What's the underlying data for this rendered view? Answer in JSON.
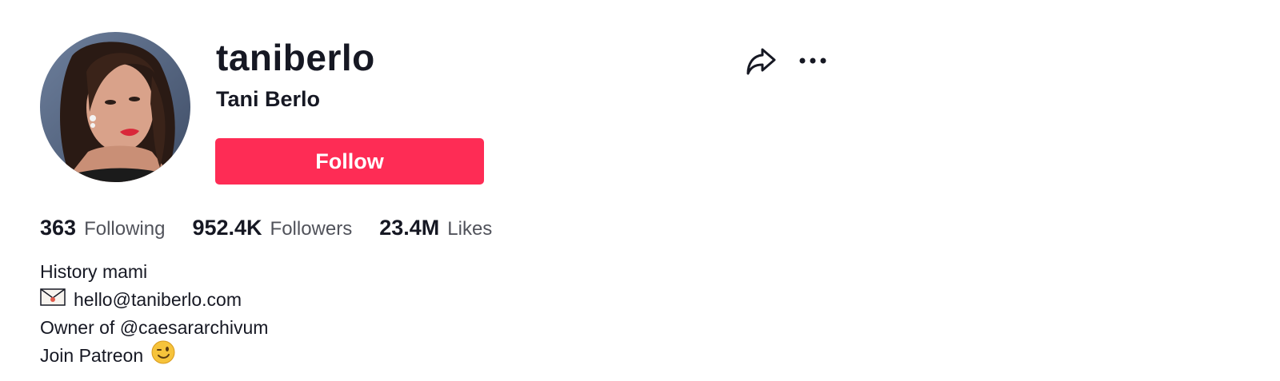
{
  "profile": {
    "username": "taniberlo",
    "nickname": "Tani Berlo",
    "avatar_icon": "profile-photo",
    "follow_label": "Follow",
    "accent_color": "#fe2c55"
  },
  "actions": {
    "share_icon": "share-arrow-icon",
    "more_icon": "more-dots-icon"
  },
  "stats": [
    {
      "value": "363",
      "label": "Following"
    },
    {
      "value": "952.4K",
      "label": "Followers"
    },
    {
      "value": "23.4M",
      "label": "Likes"
    }
  ],
  "bio": {
    "line1": "History mami",
    "line2_icon": "envelope-icon",
    "line2": "hello@taniberlo.com",
    "line3": "Owner of @caesararchivum",
    "line4": "Join Patreon",
    "line4_icon": "winking-face-emoji"
  }
}
